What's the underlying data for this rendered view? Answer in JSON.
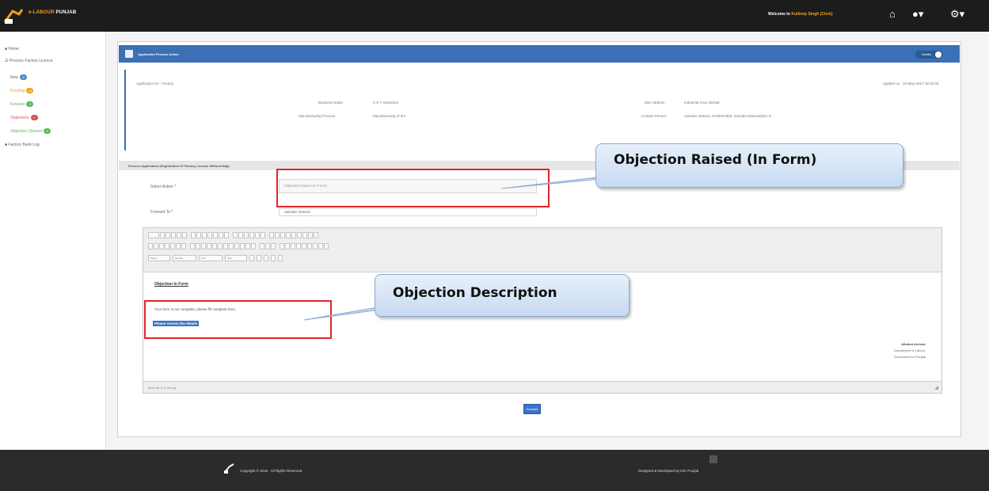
{
  "header": {
    "brand_prefix": "e-LABOUR",
    "brand_suffix": "PUNJAB",
    "welcome_prefix": "Welcome to",
    "user_name": "Kuldeep Singh (Clerk)",
    "home_icon": "home-icon",
    "user_icon": "user-icon",
    "settings_icon": "gear-icon"
  },
  "sidebar": {
    "home": "Home",
    "process": "Process Factory Licence",
    "items": [
      {
        "label": "New",
        "count": "5",
        "color": "blue"
      },
      {
        "label": "Pending",
        "count": "24",
        "color": "orange"
      },
      {
        "label": "Forward",
        "count": "2",
        "color": "green"
      },
      {
        "label": "Objections",
        "count": "1",
        "color": "red"
      },
      {
        "label": "Objection Cleared",
        "count": "0",
        "color": "green"
      }
    ],
    "factory_bank_log": "Factory Bank Log"
  },
  "panel": {
    "title": "Application Process Action",
    "details_button": "Details"
  },
  "info": {
    "app_for": "Application for : Factory",
    "applied_on": "Applied on : 10-May-2017 18:45:25",
    "business_entity_label": "Business Entity :",
    "business_entity_value": "S S T Industries",
    "manufacturing_label": "Manufacturing Process :",
    "manufacturing_value": "Manufacturing of Itm",
    "site_address_label": "Site Address :",
    "site_address_value": "Industrial Area, Mohali",
    "contact_label": "Contact Person :",
    "contact_value": "narinder sharma, 9729447865, narinder.sharma@nic.in"
  },
  "form": {
    "section_title": "Process Application (Registration Of Factory License Without Map)",
    "select_action_label": "Select Action *",
    "select_action_value": "Objection Raised (In Form)",
    "forward_to_label": "Forward To *",
    "forward_to_value": "narinder sharma",
    "forward_button": "Forward"
  },
  "editor": {
    "title": "Objection In Form",
    "line1": "Your form is not complete, please fill complete form.",
    "selected_text": "Please correct the details",
    "sig_name": "Allotted director",
    "sig_dept": "Department of Labour,",
    "sig_gov": "Government of Punjab",
    "status_path": "body  div  br  p  strong",
    "font_style": "Styles",
    "font_format": "Normal",
    "font_name": "Font",
    "font_size": "Size"
  },
  "footer": {
    "copyright": "Copyright © 2016 . All Rights Reserved.",
    "developer": "Designed & Developed by NIC Punjab"
  },
  "annotations": {
    "callout1": "Objection Raised (In Form)",
    "callout2": "Objection Description"
  }
}
